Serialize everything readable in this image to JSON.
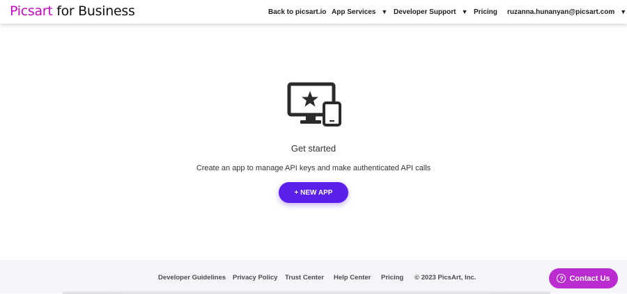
{
  "header": {
    "logo_brand": "Picsart",
    "logo_suffix": " for Business",
    "nav": {
      "back": "Back to picsart.io",
      "app_services": "App Services",
      "developer_support": "Developer Support",
      "pricing": "Pricing",
      "account": "ruzanna.hunanyan@picsart.com"
    }
  },
  "main": {
    "title": "Get started",
    "subtitle": "Create an app to manage API keys and make authenticated API calls",
    "new_app_label": "+ NEW APP",
    "icon": "devices-star-icon"
  },
  "footer": {
    "links": [
      "Developer Guidelines",
      "Privacy Policy",
      "Trust Center",
      "Help Center",
      "Pricing"
    ],
    "copyright": "© 2023 PicsArt, Inc."
  },
  "contact": {
    "label": "Contact Us",
    "icon": "question-icon"
  },
  "colors": {
    "brand_pink": "#c209c1",
    "primary_button": "#5a1fe8",
    "contact_button": "#ba2bd0",
    "footer_bg": "#f6f5fa"
  }
}
